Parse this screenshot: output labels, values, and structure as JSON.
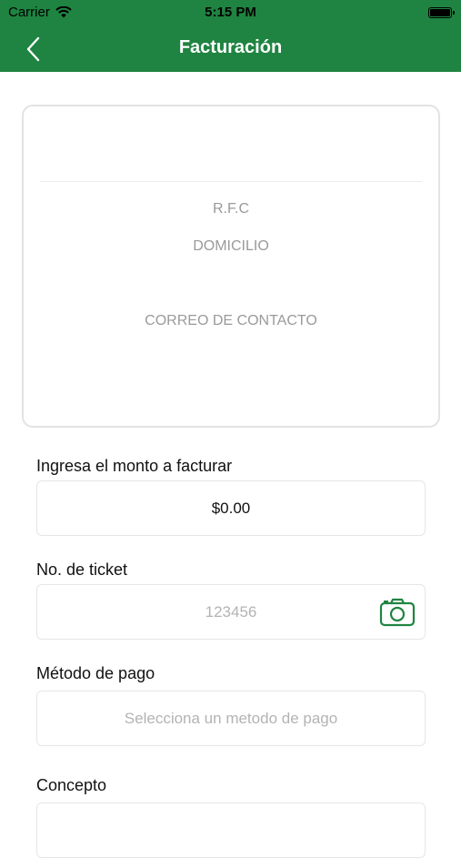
{
  "status_bar": {
    "carrier": "Carrier",
    "time": "5:15 PM"
  },
  "navbar": {
    "title": "Facturación"
  },
  "card": {
    "rfc": "R.F.C",
    "address": "DOMICILIO",
    "email": "CORREO DE CONTACTO"
  },
  "form": {
    "amount": {
      "label": "Ingresa el monto a facturar",
      "value": "$0.00"
    },
    "ticket": {
      "label": "No. de ticket",
      "placeholder": "123456"
    },
    "payment": {
      "label": "Método de pago",
      "placeholder": "Selecciona un metodo de pago"
    },
    "concept": {
      "label": "Concepto"
    }
  },
  "colors": {
    "brand": "#1f8441"
  }
}
